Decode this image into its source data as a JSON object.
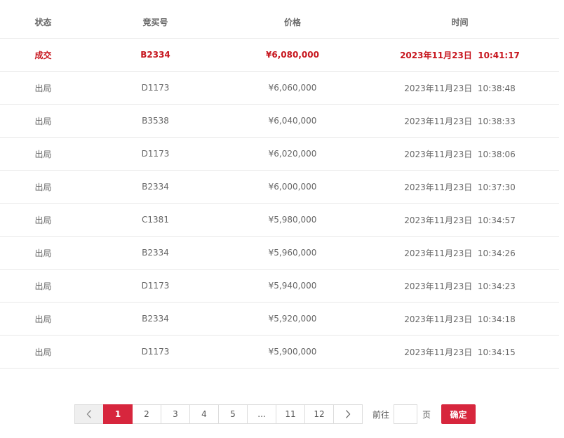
{
  "table": {
    "headers": [
      "状态",
      "竞买号",
      "价格",
      "时间"
    ],
    "rows": [
      {
        "status": "成交",
        "bidder": "B2334",
        "price": "¥6,080,000",
        "time": "2023年11月23日  10:41:17",
        "highlight": true
      },
      {
        "status": "出局",
        "bidder": "D1173",
        "price": "¥6,060,000",
        "time": "2023年11月23日  10:38:48"
      },
      {
        "status": "出局",
        "bidder": "B3538",
        "price": "¥6,040,000",
        "time": "2023年11月23日  10:38:33"
      },
      {
        "status": "出局",
        "bidder": "D1173",
        "price": "¥6,020,000",
        "time": "2023年11月23日  10:38:06"
      },
      {
        "status": "出局",
        "bidder": "B2334",
        "price": "¥6,000,000",
        "time": "2023年11月23日  10:37:30"
      },
      {
        "status": "出局",
        "bidder": "C1381",
        "price": "¥5,980,000",
        "time": "2023年11月23日  10:34:57"
      },
      {
        "status": "出局",
        "bidder": "B2334",
        "price": "¥5,960,000",
        "time": "2023年11月23日  10:34:26"
      },
      {
        "status": "出局",
        "bidder": "D1173",
        "price": "¥5,940,000",
        "time": "2023年11月23日  10:34:23"
      },
      {
        "status": "出局",
        "bidder": "B2334",
        "price": "¥5,920,000",
        "time": "2023年11月23日  10:34:18"
      },
      {
        "status": "出局",
        "bidder": "D1173",
        "price": "¥5,900,000",
        "time": "2023年11月23日  10:34:15"
      }
    ]
  },
  "pagination": {
    "prev_icon": "chevron-left-icon",
    "next_icon": "chevron-right-icon",
    "pages": [
      "1",
      "2",
      "3",
      "4",
      "5",
      "...",
      "11",
      "12"
    ],
    "current": "1",
    "goto_label": "前往",
    "goto_value": "",
    "page_unit": "页",
    "confirm_label": "确定",
    "accent_color": "#d7263d"
  },
  "colors": {
    "winner_text": "#c7161e",
    "text": "#666666",
    "row_border": "#e8e8e8"
  }
}
